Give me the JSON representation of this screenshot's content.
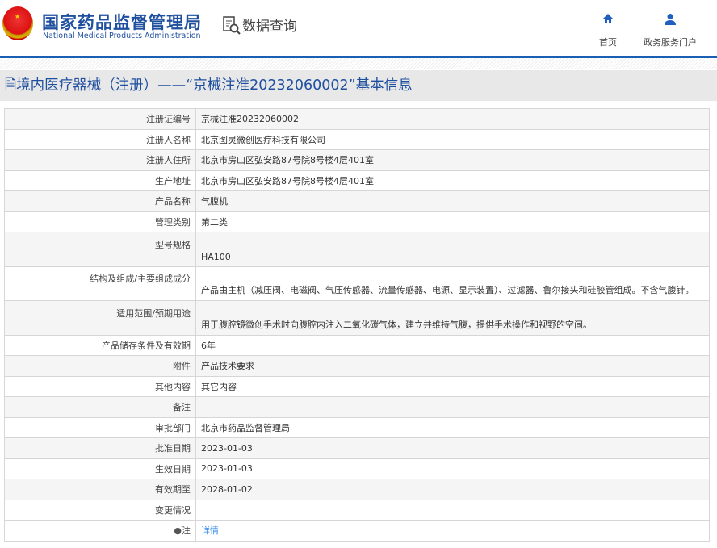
{
  "header": {
    "logo_cn": "国家药品监督管理局",
    "logo_en": "National Medical Products Administration",
    "query_label": "数据查询",
    "nav": [
      {
        "label": "首页",
        "icon": "home-icon"
      },
      {
        "label": "政务服务门户",
        "icon": "user-icon"
      }
    ]
  },
  "page_title": "境内医疗器械（注册）——“京械注准20232060002”基本信息",
  "rows": [
    {
      "label": "注册证编号",
      "value": "京械注准20232060002"
    },
    {
      "label": "注册人名称",
      "value": "北京图灵微创医疗科技有限公司"
    },
    {
      "label": "注册人住所",
      "value": "北京市房山区弘安路87号院8号楼4层401室"
    },
    {
      "label": "生产地址",
      "value": "北京市房山区弘安路87号院8号楼4层401室"
    },
    {
      "label": "产品名称",
      "value": "气腹机"
    },
    {
      "label": "管理类别",
      "value": "第二类"
    },
    {
      "label": "型号规格",
      "value": "HA100"
    },
    {
      "label": "结构及组成/主要组成成分",
      "value": "产品由主机（减压阀、电磁阀、气压传感器、流量传感器、电源、显示装置）、过滤器、鲁尔接头和硅胶管组成。不含气腹针。"
    },
    {
      "label": "适用范围/预期用途",
      "value": "用于腹腔镜微创手术时向腹腔内注入二氧化碳气体，建立并维持气腹，提供手术操作和视野的空间。"
    },
    {
      "label": "产品储存条件及有效期",
      "value": "6年"
    },
    {
      "label": "附件",
      "value": "产品技术要求"
    },
    {
      "label": "其他内容",
      "value": "其它内容"
    },
    {
      "label": "备注",
      "value": ""
    },
    {
      "label": "审批部门",
      "value": "北京市药品监督管理局"
    },
    {
      "label": "批准日期",
      "value": "2023-01-03"
    },
    {
      "label": "生效日期",
      "value": "2023-01-03"
    },
    {
      "label": "有效期至",
      "value": "2028-01-02"
    },
    {
      "label": "变更情况",
      "value": ""
    }
  ],
  "note": {
    "label": "注",
    "link": "详情"
  }
}
